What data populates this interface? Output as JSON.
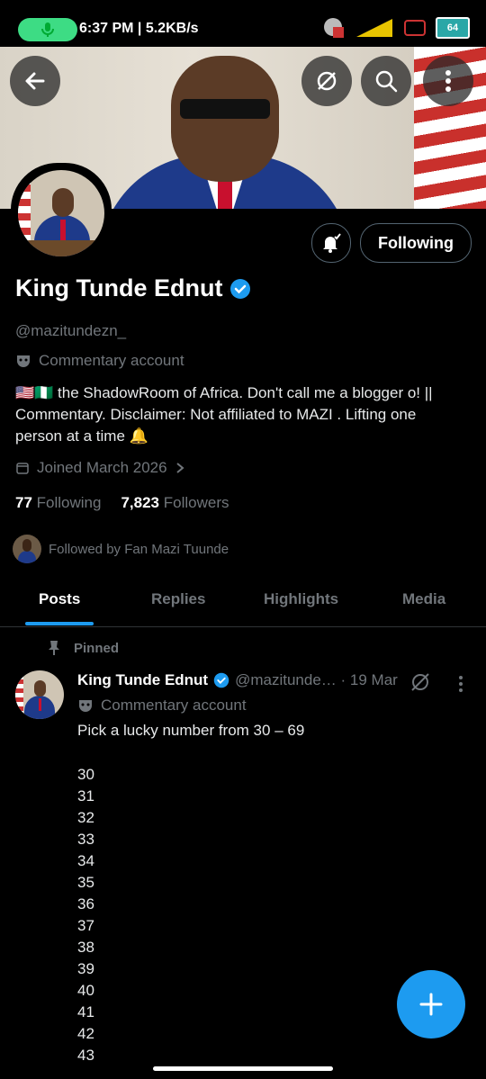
{
  "status_bar": {
    "time": "6:37 PM | 5.2KB/s",
    "battery": "64"
  },
  "profile": {
    "name": "King Tunde Ednut",
    "handle": "@mazitundezn_",
    "label": "Commentary account",
    "bio": "🇺🇸🇳🇬 the ShadowRoom of Africa. Don't call me a blogger o! || Commentary. Disclaimer: Not affiliated to MAZI . Lifting one person at a time 🔔",
    "joined": "Joined March 2026",
    "following_count": "77",
    "following_label": "Following",
    "followers_count": "7,823",
    "followers_label": "Followers",
    "followed_by": "Followed by Fan Mazi Tuunde",
    "following_button": "Following"
  },
  "tabs": [
    "Posts",
    "Replies",
    "Highlights",
    "Media"
  ],
  "post": {
    "pinned_label": "Pinned",
    "name": "King Tunde Ednut",
    "handle_date": "@mazitunde… · 19 Mar",
    "label": "Commentary account",
    "text": "Pick a lucky number from 30 – 69",
    "numbers": [
      "30",
      "31",
      "32",
      "33",
      "34",
      "35",
      "36",
      "37",
      "38",
      "39",
      "40",
      "41",
      "42",
      "43"
    ]
  },
  "colors": {
    "accent": "#1d9bf0",
    "muted": "#71767b",
    "background": "#000000"
  }
}
